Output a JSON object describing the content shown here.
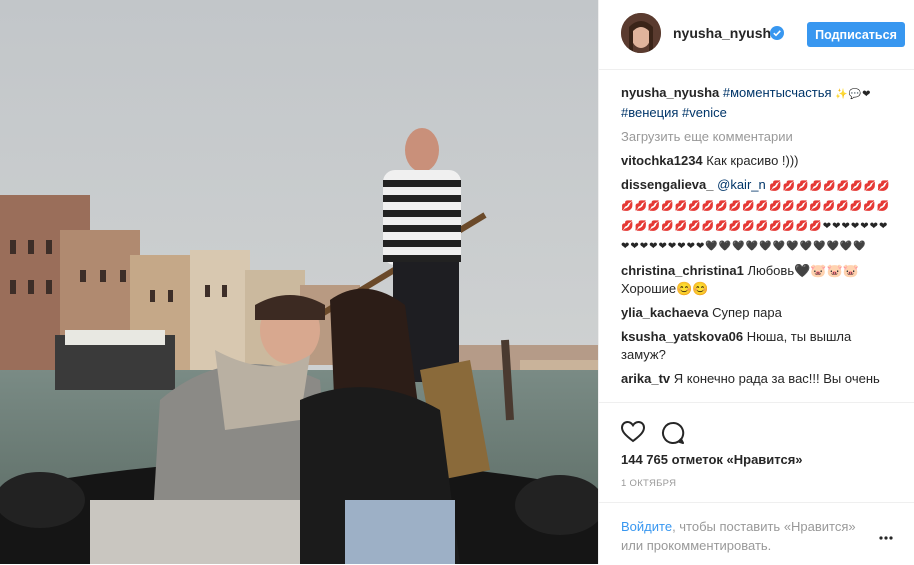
{
  "header": {
    "username": "nyusha_nyusha",
    "follow_label": "Подписаться"
  },
  "caption": {
    "username": "nyusha_nyusha",
    "tag1": "#моментысчастья",
    "emoji": "✨💬❤",
    "tag2": "#венеция",
    "tag3": "#venice"
  },
  "load_more_label": "Загрузить еще комментарии",
  "comments": [
    {
      "user": "vitochka1234",
      "text": "Как красиво !)))"
    },
    {
      "user": "dissengalieva_",
      "mention": "@kair_n",
      "emoji": "💋💋💋💋💋💋💋💋💋💋💋💋💋💋💋💋💋💋💋💋💋💋💋💋💋💋💋💋💋💋💋💋💋💋💋💋💋💋💋💋💋💋💋💋❤❤❤❤❤❤❤❤❤❤❤❤❤❤❤❤🖤🖤🖤🖤🖤🖤🖤🖤🖤🖤🖤🖤"
    },
    {
      "user": "christina_christina1",
      "text": "Любовь🖤🐷🐷🐷 Хорошие😊😊"
    },
    {
      "user": "ylia_kachaeva",
      "text": "Супер пара"
    },
    {
      "user": "ksusha_yatskova06",
      "text": "Нюша, ты вышла замуж?"
    },
    {
      "user": "arika_tv",
      "text": "Я конечно рада за вас!!! Вы очень"
    }
  ],
  "likes_text": "144 765 отметок «Нравится»",
  "date_text": "1 ОКТЯБРЯ",
  "footer": {
    "login_link": "Войдите",
    "login_text": ", чтобы поставить «Нравится» или прокомментировать."
  },
  "icons": {
    "like": "heart-icon",
    "comment": "comment-icon",
    "more": "more-icon",
    "verified": "verified-badge-icon"
  },
  "colors": {
    "accent": "#3897f0",
    "tag": "#003569",
    "muted": "#999999"
  }
}
